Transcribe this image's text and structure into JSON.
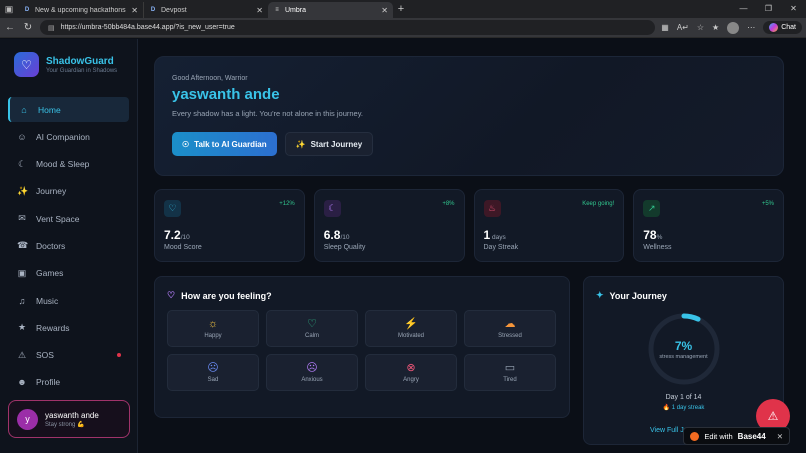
{
  "browser": {
    "tabs": [
      {
        "label": "New & upcoming hackathons - D",
        "favicon": "D"
      },
      {
        "label": "Devpost",
        "favicon": "D"
      },
      {
        "label": "Umbra",
        "favicon": "≡"
      }
    ],
    "new_tab": "+",
    "url": "https://umbra-50bb484a.base44.app/?is_new_user=true",
    "chat_label": "Chat"
  },
  "brand": {
    "name": "ShadowGuard",
    "tagline": "Your Guardian in Shadows"
  },
  "nav": [
    {
      "label": "Home",
      "icon": "home-icon",
      "glyph": "⌂",
      "active": true
    },
    {
      "label": "AI Companion",
      "icon": "bot-icon",
      "glyph": "☺"
    },
    {
      "label": "Mood & Sleep",
      "icon": "moon-icon",
      "glyph": "☾"
    },
    {
      "label": "Journey",
      "icon": "sparkle-icon",
      "glyph": "✨"
    },
    {
      "label": "Vent Space",
      "icon": "message-icon",
      "glyph": "✉"
    },
    {
      "label": "Doctors",
      "icon": "phone-icon",
      "glyph": "☎"
    },
    {
      "label": "Games",
      "icon": "gamepad-icon",
      "glyph": "▣"
    },
    {
      "label": "Music",
      "icon": "music-icon",
      "glyph": "♫"
    },
    {
      "label": "Rewards",
      "icon": "award-icon",
      "glyph": "★"
    },
    {
      "label": "SOS",
      "icon": "alert-icon",
      "glyph": "⚠",
      "alert": true
    },
    {
      "label": "Profile",
      "icon": "user-icon",
      "glyph": "☻"
    }
  ],
  "user": {
    "initial": "y",
    "name": "yaswanth ande",
    "status": "Stay strong 💪"
  },
  "hero": {
    "greeting": "Good Afternoon, Warrior",
    "name": "yaswanth ande",
    "tagline": "Every shadow has a light. You're not alone in this journey.",
    "primary_btn": "Talk to AI Guardian",
    "secondary_btn": "Start Journey"
  },
  "stats": [
    {
      "value": "7.2",
      "unit": "/10",
      "label": "Mood Score",
      "trend": "+12%",
      "icon": "heart-icon",
      "glyph": "♡",
      "color": "#39c3e8",
      "bg": "#133247"
    },
    {
      "value": "6.8",
      "unit": "/10",
      "label": "Sleep Quality",
      "trend": "+8%",
      "icon": "moon-icon",
      "glyph": "☾",
      "color": "#b07cf5",
      "bg": "#2a1f44"
    },
    {
      "value": "1",
      "unit": " days",
      "label": "Day Streak",
      "trend": "Keep going!",
      "icon": "flame-icon",
      "glyph": "♨",
      "color": "#f0577a",
      "bg": "#3d1826"
    },
    {
      "value": "78",
      "unit": "%",
      "label": "Wellness",
      "trend": "+5%",
      "icon": "trending-up-icon",
      "glyph": "↗",
      "color": "#31c48d",
      "bg": "#133a2c"
    }
  ],
  "feeling": {
    "title": "How are you feeling?",
    "moods": [
      {
        "label": "Happy",
        "icon": "sun-icon",
        "glyph": "☼",
        "color": "#f5c542"
      },
      {
        "label": "Calm",
        "icon": "heart-icon",
        "glyph": "♡",
        "color": "#31c48d"
      },
      {
        "label": "Motivated",
        "icon": "zap-icon",
        "glyph": "⚡",
        "color": "#39a9f5"
      },
      {
        "label": "Stressed",
        "icon": "cloud-icon",
        "glyph": "☁",
        "color": "#f5953a"
      },
      {
        "label": "Sad",
        "icon": "frown-icon",
        "glyph": "☹",
        "color": "#6b8cf5"
      },
      {
        "label": "Anxious",
        "icon": "meh-icon",
        "glyph": "☹",
        "color": "#b07cf5"
      },
      {
        "label": "Angry",
        "icon": "x-circle-icon",
        "glyph": "⊗",
        "color": "#f0577a"
      },
      {
        "label": "Tired",
        "icon": "battery-icon",
        "glyph": "▭",
        "color": "#9aa6b6"
      }
    ]
  },
  "journey": {
    "title": "Your Journey",
    "progress_pct": 7,
    "progress_text": "7%",
    "progress_label": "stress management",
    "day_text": "Day 1 of 14",
    "streak_text": "🔥 1 day streak",
    "link_text": "View Full Jou"
  },
  "badge": {
    "prefix": "Edit with",
    "brand": "Base44"
  },
  "colors": {
    "accent": "#39c3e8",
    "alert": "#e0334a"
  }
}
